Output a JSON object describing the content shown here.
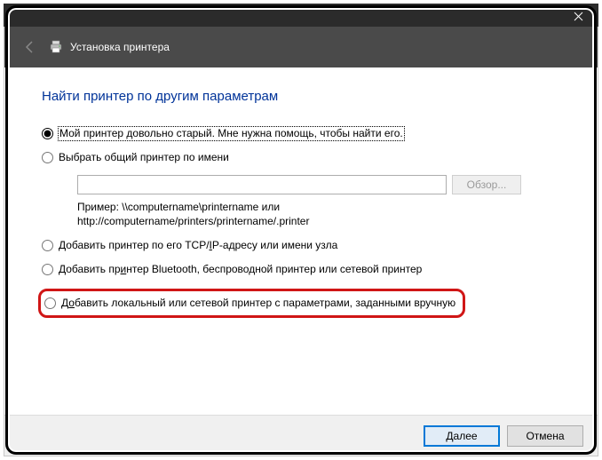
{
  "window": {
    "title": "Установка принтера"
  },
  "page": {
    "heading": "Найти принтер по другим параметрам"
  },
  "options": {
    "old_printer": "Мой принтер довольно старый. Мне нужна помощь, чтобы найти его.",
    "shared_by_name": "Выбрать общий принтер по имени",
    "shared_value": "",
    "browse_label": "Обзор...",
    "example_line1": "Пример: \\\\computername\\printername или",
    "example_line2": "http://computername/printers/printername/.printer",
    "tcpip_prefix": "Добавить принтер по его TCP/",
    "tcpip_underline": "I",
    "tcpip_suffix": "P-адресу или имени узла",
    "bluetooth_prefix": "Добавить пр",
    "bluetooth_underline": "и",
    "bluetooth_suffix": "нтер Bluetooth, беспроводной принтер или сетевой принтер",
    "manual_prefix": "Д",
    "manual_underline": "о",
    "manual_suffix": "бавить локальный или сетевой принтер с параметрами, заданными вручную"
  },
  "buttons": {
    "next": "Далее",
    "cancel": "Отмена"
  }
}
